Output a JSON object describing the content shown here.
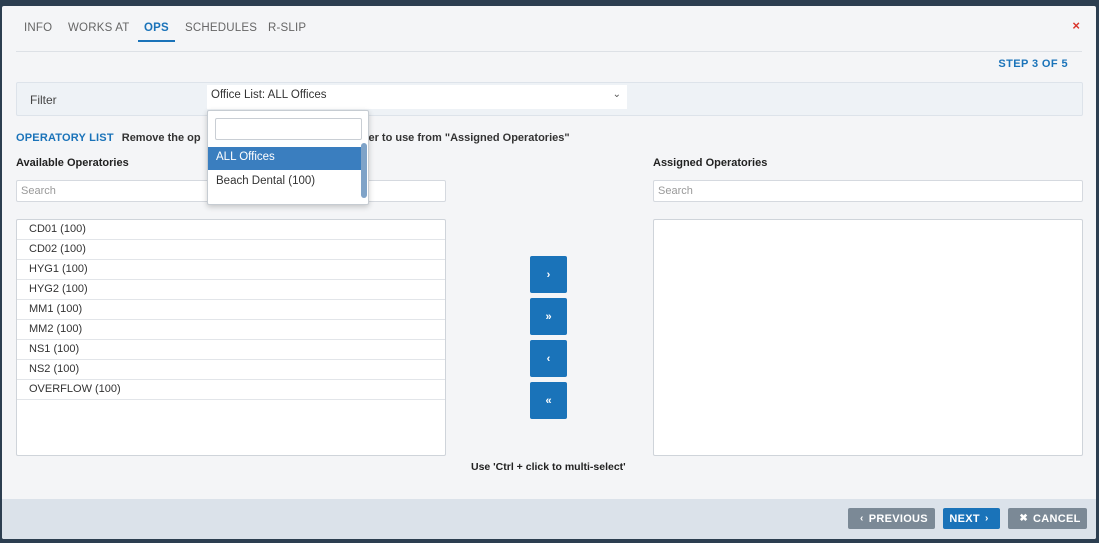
{
  "tabs": [
    {
      "label": "INFO"
    },
    {
      "label": "WORKS AT"
    },
    {
      "label": "OPS"
    },
    {
      "label": "SCHEDULES"
    },
    {
      "label": "R-SLIP"
    }
  ],
  "close_label": "×",
  "step": "STEP 3 OF 5",
  "filter": {
    "label": "Filter",
    "value": "Office List: ALL Offices",
    "options": [
      "ALL Offices",
      "Beach Dental (100)"
    ],
    "selected": "ALL Offices"
  },
  "operatory": {
    "title": "OPERATORY LIST",
    "description_left": "Remove the op",
    "description_right": "is provider to use from \"Assigned Operatories\""
  },
  "available": {
    "label": "Available Operatories",
    "search_placeholder": "Search",
    "items": [
      "CD01 (100)",
      "CD02 (100)",
      "HYG1 (100)",
      "HYG2 (100)",
      "MM1 (100)",
      "MM2 (100)",
      "NS1 (100)",
      "NS2 (100)",
      "OVERFLOW (100)"
    ]
  },
  "assigned": {
    "label": "Assigned Operatories",
    "search_placeholder": "Search",
    "items": []
  },
  "move_buttons": {
    "add_one": "›",
    "add_all": "»",
    "remove_one": "‹",
    "remove_all": "«"
  },
  "hint": "Use 'Ctrl + click to multi-select'",
  "footer": {
    "previous": "PREVIOUS",
    "next": "NEXT",
    "cancel": "CANCEL"
  },
  "colors": {
    "accent": "#1a73b9",
    "close": "#d9342b",
    "footer_gray": "#7b8996"
  }
}
